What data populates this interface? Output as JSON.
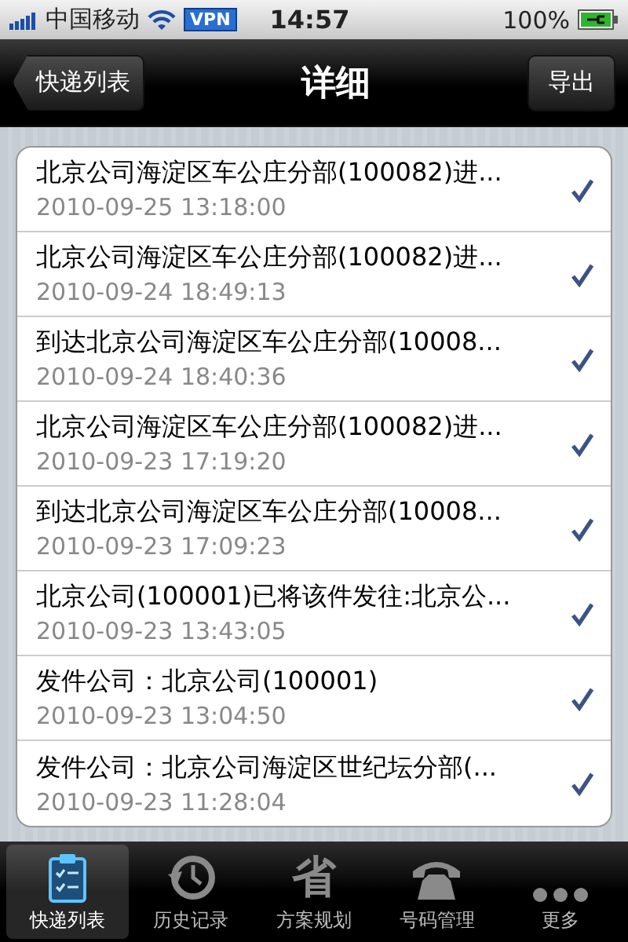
{
  "status_bar": {
    "carrier": "中国移动",
    "vpn": "VPN",
    "time": "14:57",
    "battery": "100%"
  },
  "nav": {
    "back": "快递列表",
    "title": "详细",
    "action": "导出"
  },
  "rows": [
    {
      "text": "北京公司海淀区车公庄分部(100082)进...",
      "time": "2010-09-25 13:18:00",
      "checked": true
    },
    {
      "text": "北京公司海淀区车公庄分部(100082)进...",
      "time": "2010-09-24 18:49:13",
      "checked": true
    },
    {
      "text": "到达北京公司海淀区车公庄分部(10008...",
      "time": "2010-09-24 18:40:36",
      "checked": true
    },
    {
      "text": "北京公司海淀区车公庄分部(100082)进...",
      "time": "2010-09-23 17:19:20",
      "checked": true
    },
    {
      "text": "到达北京公司海淀区车公庄分部(10008...",
      "time": "2010-09-23 17:09:23",
      "checked": true
    },
    {
      "text": "北京公司(100001)已将该件发往:北京公...",
      "time": "2010-09-23 13:43:05",
      "checked": true
    },
    {
      "text": "发件公司：北京公司(100001)",
      "time": "2010-09-23 13:04:50",
      "checked": true
    },
    {
      "text": "发件公司：北京公司海淀区世纪坛分部(...",
      "time": "2010-09-23 11:28:04",
      "checked": true
    }
  ],
  "tabs": [
    {
      "label": "快递列表",
      "kind": "clipboard",
      "selected": true
    },
    {
      "label": "历史记录",
      "kind": "clock",
      "selected": false
    },
    {
      "label": "方案规划",
      "kind": "glyph",
      "glyph": "省",
      "selected": false
    },
    {
      "label": "号码管理",
      "kind": "phone",
      "selected": false
    },
    {
      "label": "更多",
      "kind": "more",
      "selected": false
    }
  ]
}
